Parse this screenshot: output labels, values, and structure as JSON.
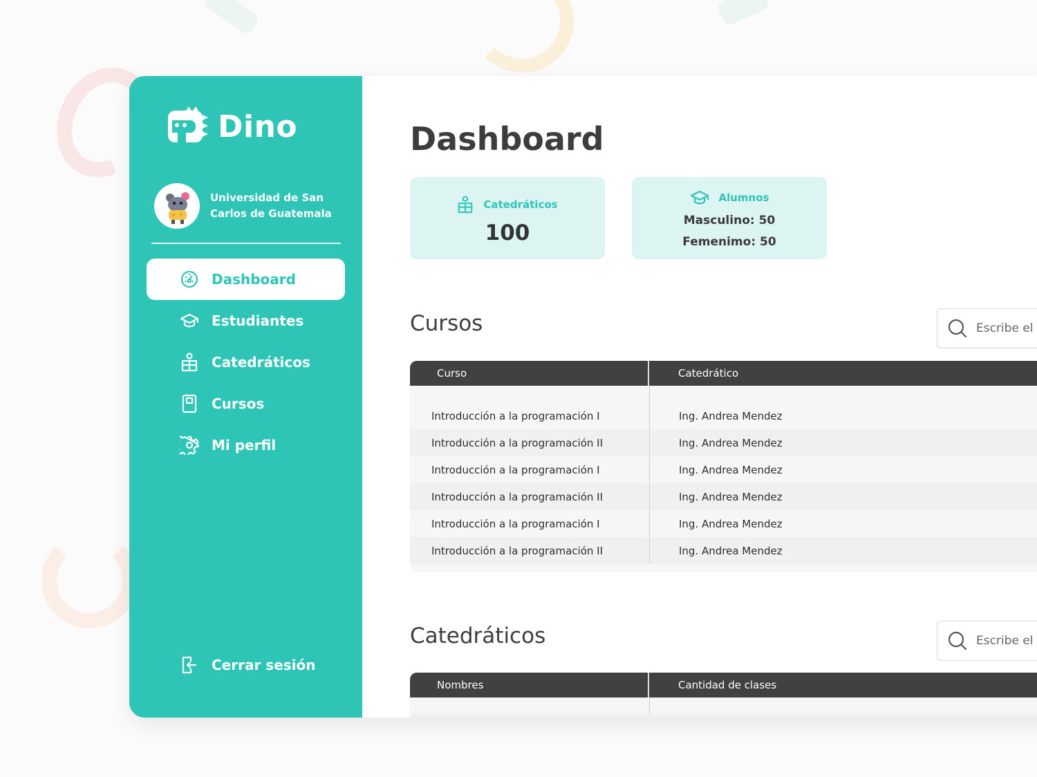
{
  "brand": {
    "name": "Dino"
  },
  "org": {
    "name": "Universidad de San Carlos de Guatemala"
  },
  "nav": {
    "items": [
      {
        "label": "Dashboard",
        "icon": "dashboard-icon",
        "active": true
      },
      {
        "label": "Estudiantes",
        "icon": "graduation-cap-icon"
      },
      {
        "label": "Catedráticos",
        "icon": "teacher-icon"
      },
      {
        "label": "Cursos",
        "icon": "book-icon"
      },
      {
        "label": "Mi perfil",
        "icon": "gear-icon"
      }
    ],
    "logout": {
      "label": "Cerrar sesión",
      "icon": "logout-icon"
    }
  },
  "page": {
    "title": "Dashboard"
  },
  "stats": {
    "teachers": {
      "label": "Catedráticos",
      "value": "100"
    },
    "students": {
      "label": "Alumnos",
      "male": "Masculino: 50",
      "female": "Femenimo: 50"
    }
  },
  "courses": {
    "title": "Cursos",
    "search_placeholder": "Escribe el r",
    "columns": [
      "Curso",
      "Catedrático"
    ],
    "rows": [
      [
        "Introducción a la programación I",
        "Ing. Andrea Mendez"
      ],
      [
        "Introducción a la programación II",
        "Ing. Andrea Mendez"
      ],
      [
        "Introducción a la programación I",
        "Ing. Andrea Mendez"
      ],
      [
        "Introducción a la programación II",
        "Ing. Andrea Mendez"
      ],
      [
        "Introducción a la programación I",
        "Ing. Andrea Mendez"
      ],
      [
        "Introducción a la programación II",
        "Ing. Andrea Mendez"
      ]
    ]
  },
  "teachers": {
    "title": "Catedráticos",
    "search_placeholder": "Escribe el r",
    "columns": [
      "Nombres",
      "Cantidad de clases"
    ]
  },
  "colors": {
    "accent": "#2ec4b6",
    "accent_light": "#dcf4f2",
    "header_dark": "#414141",
    "text_dark": "#3d3d3d"
  }
}
